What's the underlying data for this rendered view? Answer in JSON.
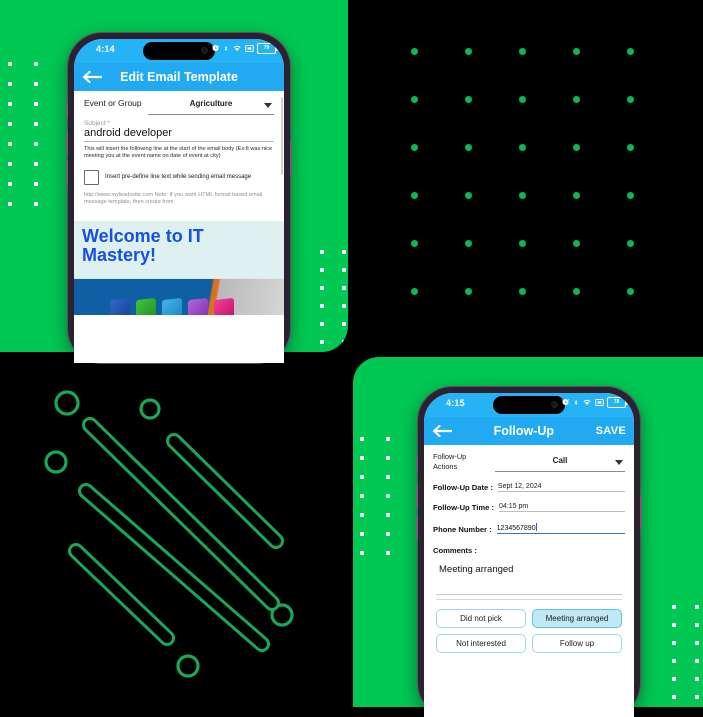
{
  "theme": {
    "green": "#00c853",
    "black": "#000000",
    "app_blue": "#21aaf2",
    "status_blue": "#25b3f5",
    "mail_heading_blue": "#1551e0",
    "chip_selected": "#bfe9f6",
    "dot_green": "#0ab85a",
    "dot_white": "#ffffff"
  },
  "panels": {
    "top_left_label": "green-dots-panel",
    "top_right_label": "black-dot-grid-panel",
    "bottom_left_label": "black-diagonal-lines-panel",
    "bottom_right_label": "green-dots-panel"
  },
  "phone1": {
    "status": {
      "time": "4:14",
      "icons": [
        "alarm-icon",
        "bluetooth-icon",
        "wifi-icon",
        "cast-icon",
        "battery-icon"
      ],
      "battery_level": "79"
    },
    "appbar": {
      "back_icon": "back-arrow-icon",
      "title": "Edit Email Template"
    },
    "form": {
      "event_group_label": "Event or Group",
      "event_group_value": "Agriculture",
      "subject_label": "Subject *",
      "subject_value": "android developer",
      "hint": "This will insert the following line at the start of the email body (Ex:It was nice meeting you at the event name on date of event at city)",
      "checkbox_label": "Insert pre-define line text while sending email message",
      "checkbox_checked": false,
      "note": "http://www.myleadssite.com Note: If you want HTML format based email message template, then create from"
    },
    "preview": {
      "heading": "Welcome to IT Mastery!",
      "image_alt": "blue banner with colorful 3D app icons"
    }
  },
  "phone2": {
    "status": {
      "time": "4:15",
      "icons": [
        "alarm-icon",
        "bluetooth-icon",
        "wifi-icon",
        "cast-icon",
        "battery-icon"
      ],
      "battery_level": "78"
    },
    "appbar": {
      "back_icon": "back-arrow-icon",
      "title": "Follow-Up",
      "save_label": "SAVE"
    },
    "form": {
      "actions_label": "Follow-Up Actions",
      "actions_value": "Call",
      "date_label": "Follow-Up Date :",
      "date_value": "Sept 12, 2024",
      "time_label": "Follow-Up Time :",
      "time_value": "04:15 pm",
      "phone_label": "Phone Number :",
      "phone_value": "1234567890",
      "comments_label": "Comments :",
      "comments_value": "Meeting arranged"
    },
    "chips": [
      {
        "label": "Did not pick",
        "selected": false
      },
      {
        "label": "Meeting arranged",
        "selected": true
      },
      {
        "label": "Not interested",
        "selected": false
      },
      {
        "label": "Follow up",
        "selected": false
      }
    ]
  }
}
